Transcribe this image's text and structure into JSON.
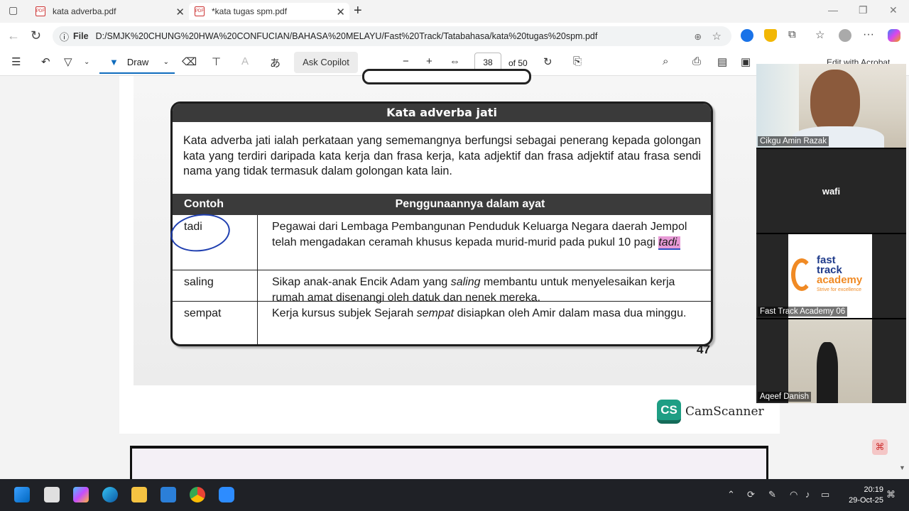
{
  "tabs": [
    {
      "title": "kata adverba.pdf"
    },
    {
      "title": "*kata tugas spm.pdf"
    }
  ],
  "address": {
    "scheme_label": "File",
    "url": "D:/SMJK%20CHUNG%20HWA%20CONFUCIAN/BAHASA%20MELAYU/Fast%20Track/Tatabahasa/kata%20tugas%20spm.pdf"
  },
  "pdf_toolbar": {
    "draw_label": "Draw",
    "copilot_label": "Ask Copilot",
    "page_number": "38",
    "page_count": "of 50",
    "edit_label": "Edit with Acrobat"
  },
  "document": {
    "heading": "Kata adverba jati",
    "definition": "Kata adverba jati ialah perkataan yang sememangnya berfungsi sebagai penerang kepada golongan kata yang terdiri daripada kata kerja dan frasa kerja, kata adjektif dan frasa adjektif atau frasa sendi nama yang tidak termasuk dalam golongan kata lain.",
    "table": {
      "col1": "Contoh",
      "col2": "Penggunaannya dalam ayat",
      "rows": [
        {
          "word": "tadi",
          "sentence_a": "Pegawai dari Lembaga Pembangunan Penduduk Keluarga Negara daerah Jempol telah mengadakan ceramah khusus kepada murid-murid pada pukul 10 pagi ",
          "sentence_em": "tadi.",
          "sentence_b": ""
        },
        {
          "word": "saling",
          "sentence_a": "Sikap anak-anak Encik Adam yang ",
          "sentence_em": "saling",
          "sentence_b": " membantu untuk menyelesaikan kerja rumah amat disenangi oleh datuk dan nenek mereka."
        },
        {
          "word": "sempat",
          "sentence_a": "Kerja kursus subjek Sejarah  ",
          "sentence_em": "sempat",
          "sentence_b": " disiapkan oleh Amir dalam masa dua minggu."
        }
      ]
    },
    "page_number": "47",
    "watermark": "CamScanner",
    "watermark_logo": "CS"
  },
  "participants": [
    {
      "name": "Cikgu Amin Razak"
    },
    {
      "name": "wafi"
    },
    {
      "name": "Fast Track Academy 06",
      "logo_line1": "fast",
      "logo_line2": "track",
      "logo_line3": "academy",
      "logo_tagline": "Strive for excellence"
    },
    {
      "name": "Aqeef Danish"
    }
  ],
  "taskbar": {
    "time": "20:19",
    "date": "29-Oct-25"
  },
  "colors": {
    "accent": "#0f6cbd",
    "highlight": "#e79ad6",
    "ink": "#1f3fb0",
    "camscanner": "#1e9e84"
  }
}
